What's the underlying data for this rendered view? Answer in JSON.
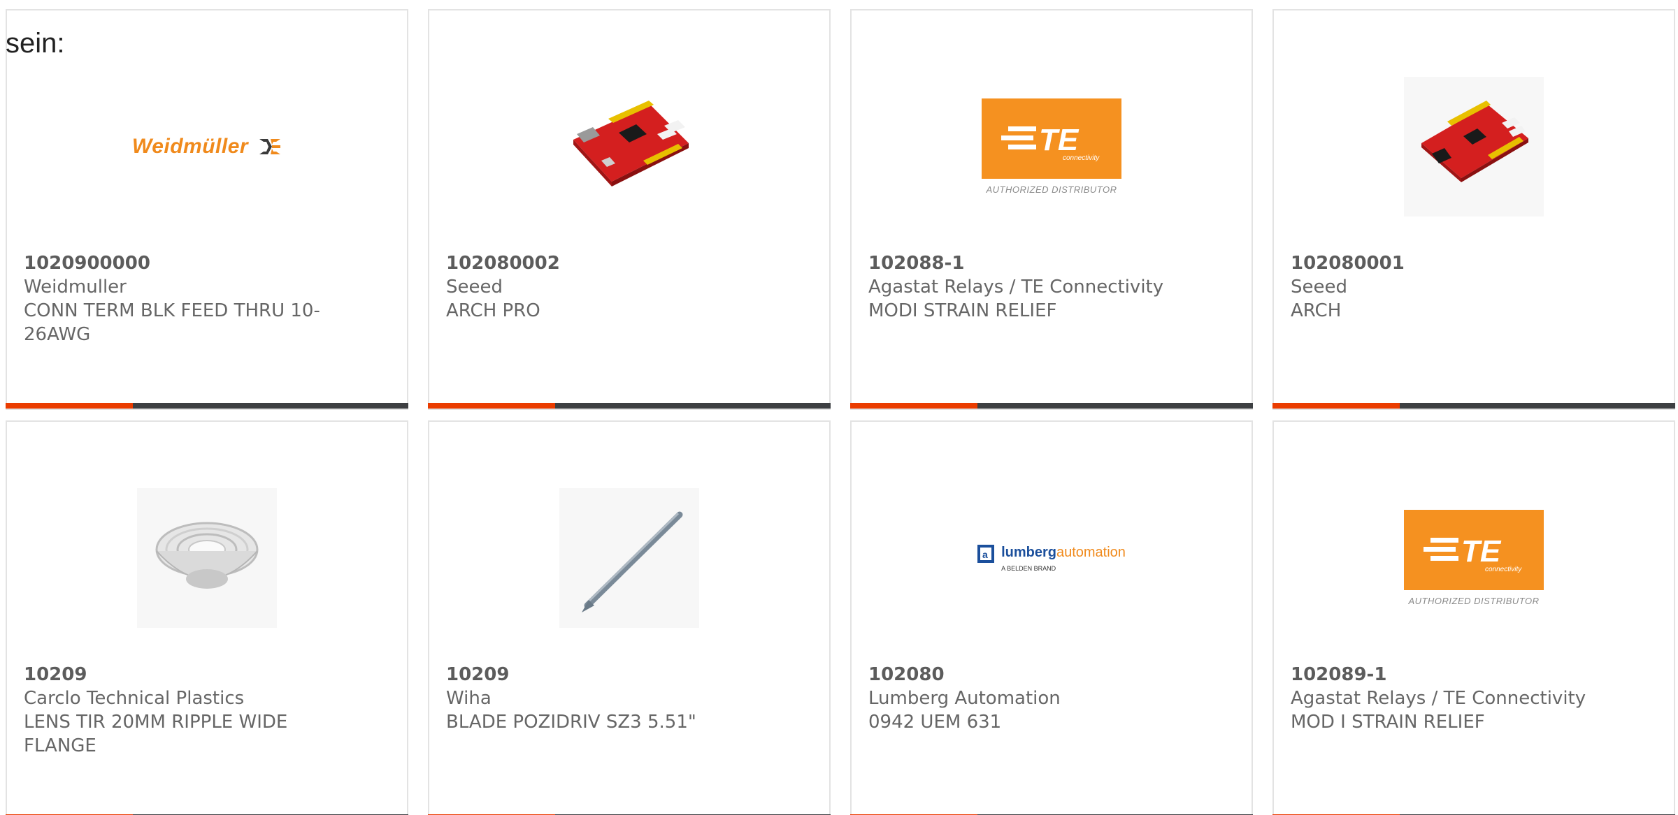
{
  "intro_text": "sein:",
  "products": [
    {
      "part_number": "1020900000",
      "manufacturer": "Weidmuller",
      "description": "CONN TERM BLK FEED THRU 10-26AWG",
      "image": "weidmuller-logo"
    },
    {
      "part_number": "102080002",
      "manufacturer": "Seeed",
      "description": "ARCH PRO",
      "image": "red-dev-board-photo"
    },
    {
      "part_number": "102088-1",
      "manufacturer": "Agastat Relays / TE Connectivity",
      "description": "MODI STRAIN RELIEF",
      "image": "te-connectivity-logo"
    },
    {
      "part_number": "102080001",
      "manufacturer": "Seeed",
      "description": "ARCH",
      "image": "red-dev-board-photo"
    },
    {
      "part_number": "10209",
      "manufacturer": "Carclo Technical Plastics",
      "description": "LENS TIR 20MM RIPPLE WIDE FLANGE",
      "image": "clear-lens-photo"
    },
    {
      "part_number": "10209",
      "manufacturer": "Wiha",
      "description": "BLADE POZIDRIV SZ3 5.51\"",
      "image": "screwdriver-blade-photo"
    },
    {
      "part_number": "102080",
      "manufacturer": "Lumberg Automation",
      "description": "0942 UEM 631",
      "image": "lumberg-automation-logo"
    },
    {
      "part_number": "102089-1",
      "manufacturer": "Agastat Relays / TE Connectivity",
      "description": "MOD I STRAIN RELIEF",
      "image": "te-connectivity-logo"
    }
  ],
  "logos": {
    "weidmuller": "Weidmüller",
    "te_main": "TE",
    "te_connectivity": "connectivity",
    "te_authorized": "AUTHORIZED DISTRIBUTOR",
    "lumberg_a": "lumberg",
    "lumberg_b": "automation",
    "lumberg_sub": "A BELDEN BRAND"
  },
  "colors": {
    "accent": "#ea3c00",
    "bar": "#3d3f42",
    "te_orange": "#f59120",
    "weidmuller_orange": "#f08a1c",
    "lumberg_blue": "#1b4f9c",
    "lumberg_orange": "#f08a1c",
    "text": "#666666"
  }
}
